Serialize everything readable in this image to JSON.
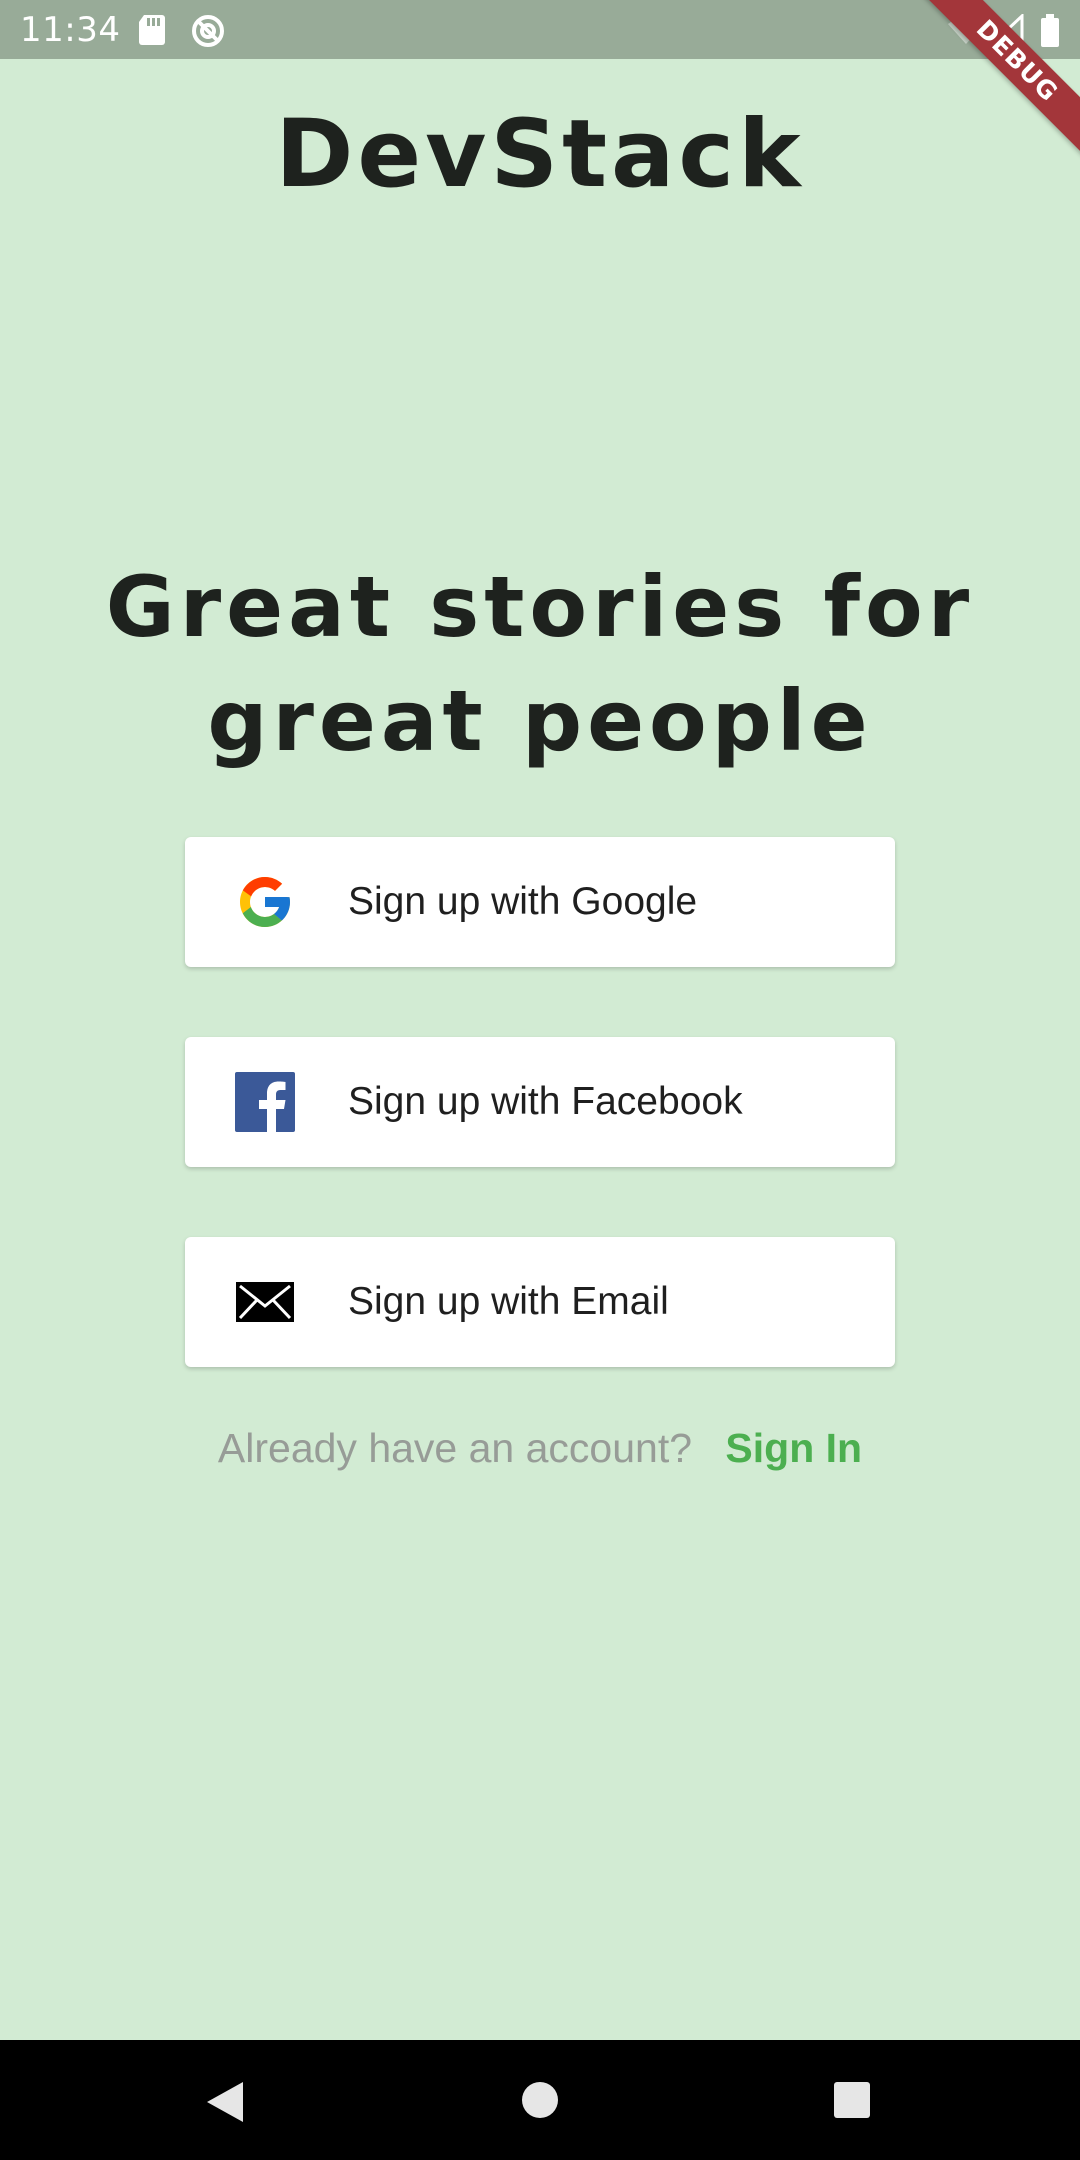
{
  "status_bar": {
    "time": "11:34",
    "icons": [
      "sd-card-icon",
      "sync-icon",
      "wifi-icon",
      "signal-icon",
      "battery-icon"
    ]
  },
  "debug_banner": "DEBUG",
  "app_title": "DevStack",
  "tagline": {
    "line1": "Great stories for",
    "line2": "great people"
  },
  "auth_buttons": {
    "google": {
      "label": "Sign up with Google",
      "icon": "google-icon"
    },
    "facebook": {
      "label": "Sign up with Facebook",
      "icon": "facebook-icon"
    },
    "email": {
      "label": "Sign up with Email",
      "icon": "mail-icon"
    }
  },
  "signin": {
    "prompt": "Already have an account?",
    "link": "Sign In"
  },
  "nav_bar": {
    "icons": [
      "back-icon",
      "home-icon",
      "recents-icon"
    ]
  },
  "colors": {
    "background": "#d2ebd3",
    "status_bar": "#98ab98",
    "accent": "#4caf50",
    "debug_banner": "#a3363a",
    "facebook_blue": "#3b5998"
  }
}
